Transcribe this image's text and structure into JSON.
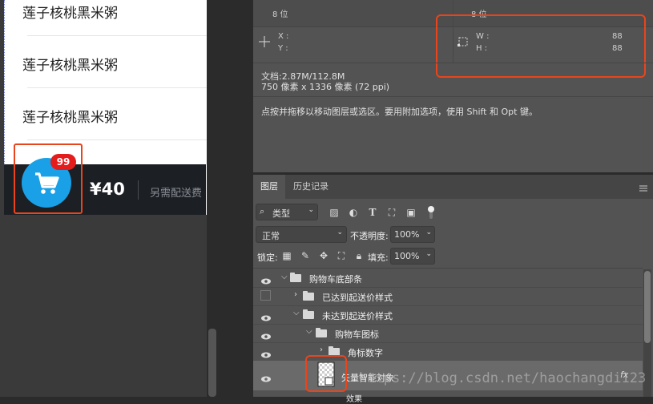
{
  "left_canvas": {
    "food_items": [
      "莲子核桃黑米粥",
      "莲子核桃黑米粥",
      "莲子核桃黑米粥"
    ],
    "cart_badge": "99",
    "price": "¥40",
    "delivery_text": "另需配送费"
  },
  "info": {
    "bits_left": "8 位",
    "bits_right": "8 位",
    "x_label": "X :",
    "y_label": "Y :",
    "w_label": "W :",
    "h_label": "H :",
    "w_value": "88",
    "h_value": "88",
    "doc_size": "文档:2.87M/112.8M",
    "doc_pixels": "750 像素 x 1336 像素 (72 ppi)",
    "hint": "点按并拖移以移动图层或选区。要用附加选项，使用 Shift 和 Opt 键。"
  },
  "layers_panel": {
    "tab_layers": "图层",
    "tab_history": "历史记录",
    "filter_kind": "类型",
    "blend_mode": "正常",
    "opacity_label": "不透明度:",
    "opacity_value": "100%",
    "lock_label": "锁定:",
    "fill_label": "填充:",
    "fill_value": "100%",
    "layers": [
      {
        "name": "购物车底部条"
      },
      {
        "name": "已达到起送价样式"
      },
      {
        "name": "未达到起送价样式"
      },
      {
        "name": "购物车图标"
      },
      {
        "name": "角标数字"
      },
      {
        "name": "矢量智能对象"
      },
      {
        "name": "效果"
      }
    ],
    "fx_label": "fx"
  },
  "watermark": "https://blog.csdn.net/haochangdi123",
  "colors": {
    "accent_red": "#e8451c",
    "cart_blue": "#1aa0e6",
    "badge_red": "#e51c1c",
    "panel_gray": "#535353"
  }
}
